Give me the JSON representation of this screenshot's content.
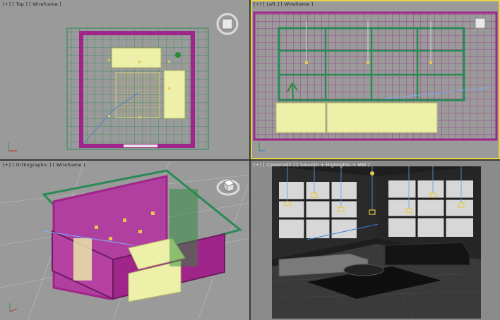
{
  "viewports": [
    {
      "id": "top",
      "label": "[+] [ Top ] [ Wireframe ]",
      "active": false
    },
    {
      "id": "left",
      "label": "[+] [ Left ] [ Wireframe ]",
      "active": true
    },
    {
      "id": "ortho",
      "label": "[+] [ Orthographic ] [ Wireframe ]",
      "active": false
    },
    {
      "id": "camera",
      "label": "[+] [ Camera02 ] [ Smooth + Highlights + MW ]",
      "active": false
    }
  ],
  "colors": {
    "grid": "#2a8a55",
    "room": "#a0258a",
    "furniture": "#ecf0a8",
    "bg": "#9a9a9a",
    "camera_bg": "#1e1e1e",
    "frame": "#2b2b2b",
    "light": "#e8c84a",
    "active": "#e8d34a"
  },
  "icons": [
    "viewcube-icon",
    "axis-tripod-icon",
    "camera-icon",
    "plant-icon",
    "light-icon"
  ]
}
